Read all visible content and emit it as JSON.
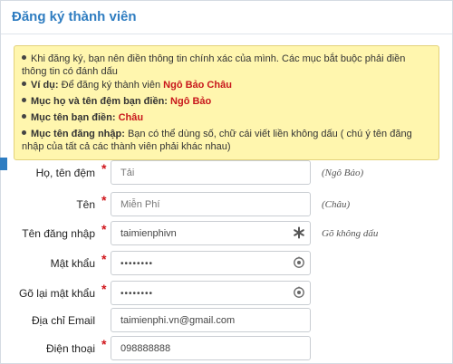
{
  "header": {
    "title": "Đăng ký thành viên"
  },
  "notice": {
    "item1": {
      "text": "Khi đăng ký, bạn nên điền thông tin chính xác của mình. Các mục bắt buộc phải điền thông tin có đánh dấu"
    },
    "item2": {
      "label": "Ví dụ:",
      "text": "Để đăng ký thành viên",
      "value": "Ngô Bảo Châu"
    },
    "item3": {
      "label": "Mục họ và tên đệm bạn điền:",
      "value": "Ngô Bảo"
    },
    "item4": {
      "label": "Mục tên bạn điền:",
      "value": "Châu"
    },
    "item5": {
      "label": "Mục tên đăng nhập:",
      "text": "Bạn có thể dùng số, chữ cái viết liền không dấu ( chú ý tên đăng nhập của tất cả các thành viên phải khác nhau)"
    }
  },
  "form": {
    "required_mark": "*",
    "fields": [
      {
        "label": "Họ, tên đệm",
        "value": "Tải",
        "hint": "(Ngô Bảo)"
      },
      {
        "label": "Tên",
        "value": "Miễn Phí",
        "hint": "(Châu)"
      },
      {
        "label": "Tên đăng nhập",
        "value": "taimienphivn",
        "hint": "Gõ không dấu",
        "icon": "asterisk-icon"
      },
      {
        "label": "Mật khẩu",
        "value": "••••••••",
        "icon": "password-toggle-icon"
      },
      {
        "label": "Gõ lại mật khẩu",
        "value": "••••••••",
        "icon": "password-toggle-icon"
      },
      {
        "label": "Địa chỉ Email",
        "value": "taimienphi.vn@gmail.com"
      },
      {
        "label": "Điện thoại",
        "value": "098888888"
      }
    ]
  },
  "colors": {
    "accent": "#2f7dc1",
    "required": "#d0151b",
    "notice_bg": "#fff6ae",
    "highlight": "#c8171c"
  }
}
